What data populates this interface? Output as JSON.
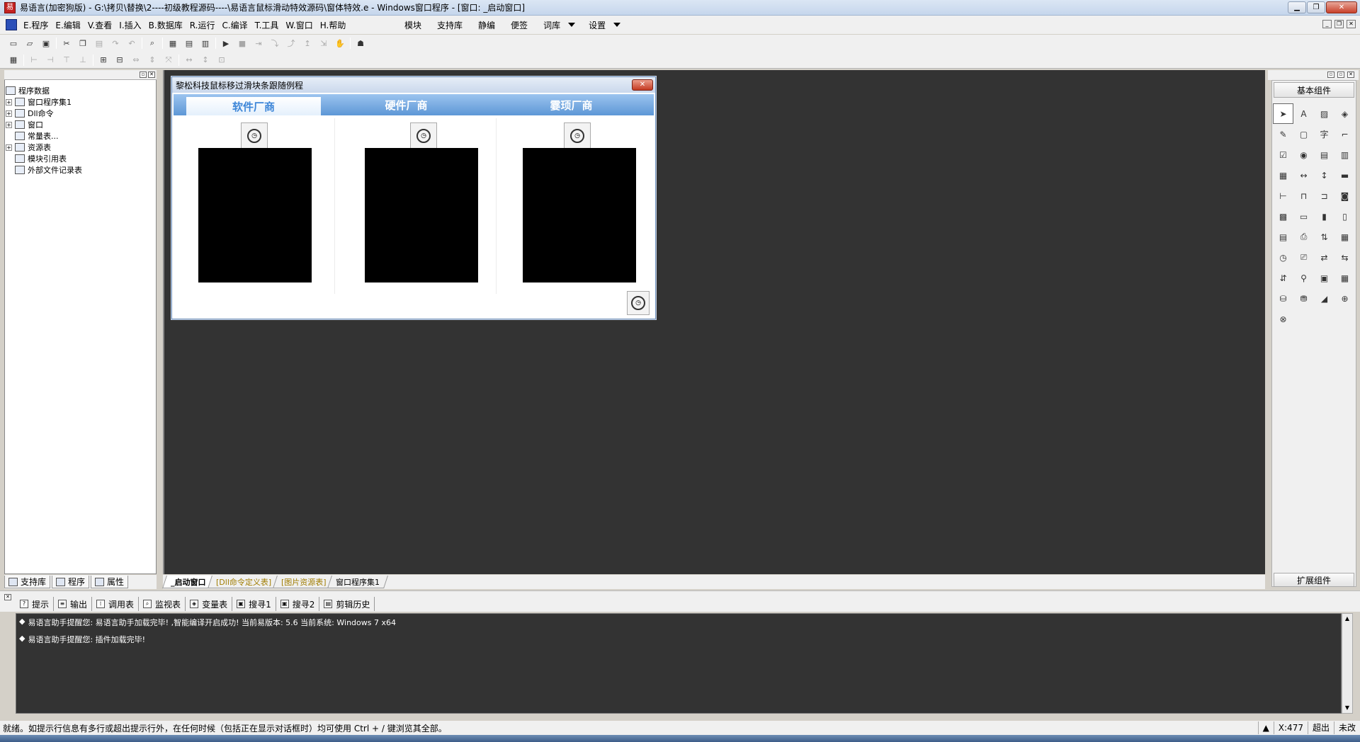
{
  "window": {
    "title": "易语言(加密狗版) - G:\\拷贝\\替换\\2----初级教程源码----\\易语言鼠标滑动特效源码\\窗体特效.e - Windows窗口程序 - [窗口: _启动窗口]"
  },
  "menu": {
    "items": [
      "E.程序",
      "E.编辑",
      "V.查看",
      "I.插入",
      "B.数据库",
      "R.运行",
      "C.编译",
      "T.工具",
      "W.窗口",
      "H.帮助"
    ],
    "right_items": [
      "模块",
      "支持库",
      "静编",
      "便签",
      "词库",
      "设置"
    ]
  },
  "left_panel": {
    "tree_root": "程序数据",
    "tree_items": [
      "窗口程序集1",
      "Dll命令",
      "窗口",
      "常量表...",
      "资源表",
      "模块引用表",
      "外部文件记录表"
    ],
    "tabs": [
      "支持库",
      "程序",
      "属性"
    ]
  },
  "design_window": {
    "title": "黎松科技鼠标移过滑块条跟随例程",
    "tabs": [
      "软件厂商",
      "硬件厂商",
      "霎顼厂商"
    ],
    "active_tab": "软件厂商"
  },
  "doc_tabs": [
    "_启动窗口",
    "[Dll命令定义表]",
    "[图片资源表]",
    "窗口程序集1"
  ],
  "right_panel": {
    "title": "基本组件",
    "footer": "扩展组件"
  },
  "bottom": {
    "tabs": [
      "提示",
      "输出",
      "调用表",
      "监视表",
      "变量表",
      "搜寻1",
      "搜寻2",
      "剪辑历史"
    ],
    "output_lines": [
      "易语言助手提醒您: 易语言助手加载完毕! ,智能编译开启成功! 当前易版本: 5.6 当前系统: Windows 7 x64",
      "易语言助手提醒您: 插件加载完毕!"
    ]
  },
  "status": {
    "text": "就绪。如提示行信息有多行或超出提示行外，在任何时候（包括正在显示对话框时）均可使用 Ctrl + / 键浏览其全部。",
    "position": "X:477",
    "mode": "超出",
    "state": "未改"
  },
  "colors": {
    "design_bg": "#333333",
    "tab_bar": "#5d97d6",
    "active_tab_text": "#3d86d8"
  }
}
